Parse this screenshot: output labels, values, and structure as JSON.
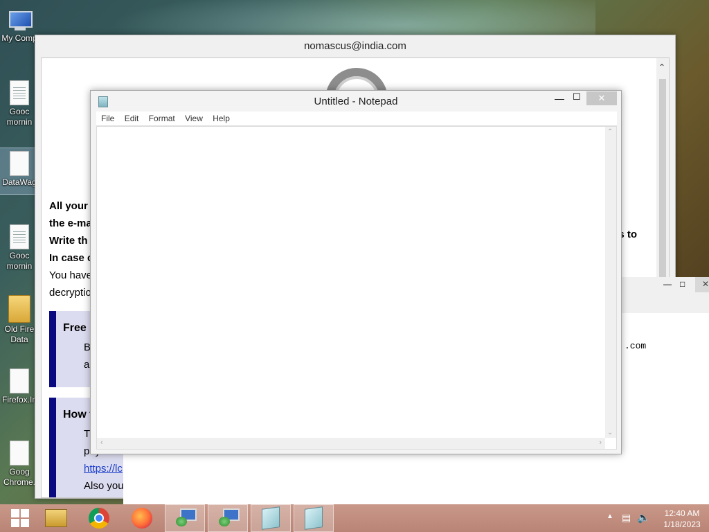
{
  "desktop": {
    "icons": [
      {
        "label": "My Comp"
      },
      {
        "label": "Gooc\nmornin"
      },
      {
        "label": "DataWag"
      },
      {
        "label": "Gooc\nmornin"
      },
      {
        "label": "Old Fire\nData"
      },
      {
        "label": "Firefox.In"
      },
      {
        "label": "Goog\nChrome."
      }
    ]
  },
  "ransom_window": {
    "title": "nomascus@india.com",
    "lines": [
      "All your",
      "the e-ma",
      "Write th",
      "In case c",
      "You have",
      "decryptio"
    ],
    "line_tail": "s to",
    "box1": {
      "heading": "Free c",
      "lines": [
        "B",
        "ar"
      ]
    },
    "box2": {
      "heading": "How t",
      "lines": [
        "T",
        "payment",
        "https://lc",
        "Also you"
      ]
    }
  },
  "second_window": {
    "text": ".com"
  },
  "notepad": {
    "title": "Untitled - Notepad",
    "menu": [
      "File",
      "Edit",
      "Format",
      "View",
      "Help"
    ],
    "content": "",
    "minimize": "—",
    "maximize": "☐",
    "close": "✕"
  },
  "taskbar": {
    "clock_time": "12:40 AM",
    "clock_date": "1/18/2023"
  }
}
